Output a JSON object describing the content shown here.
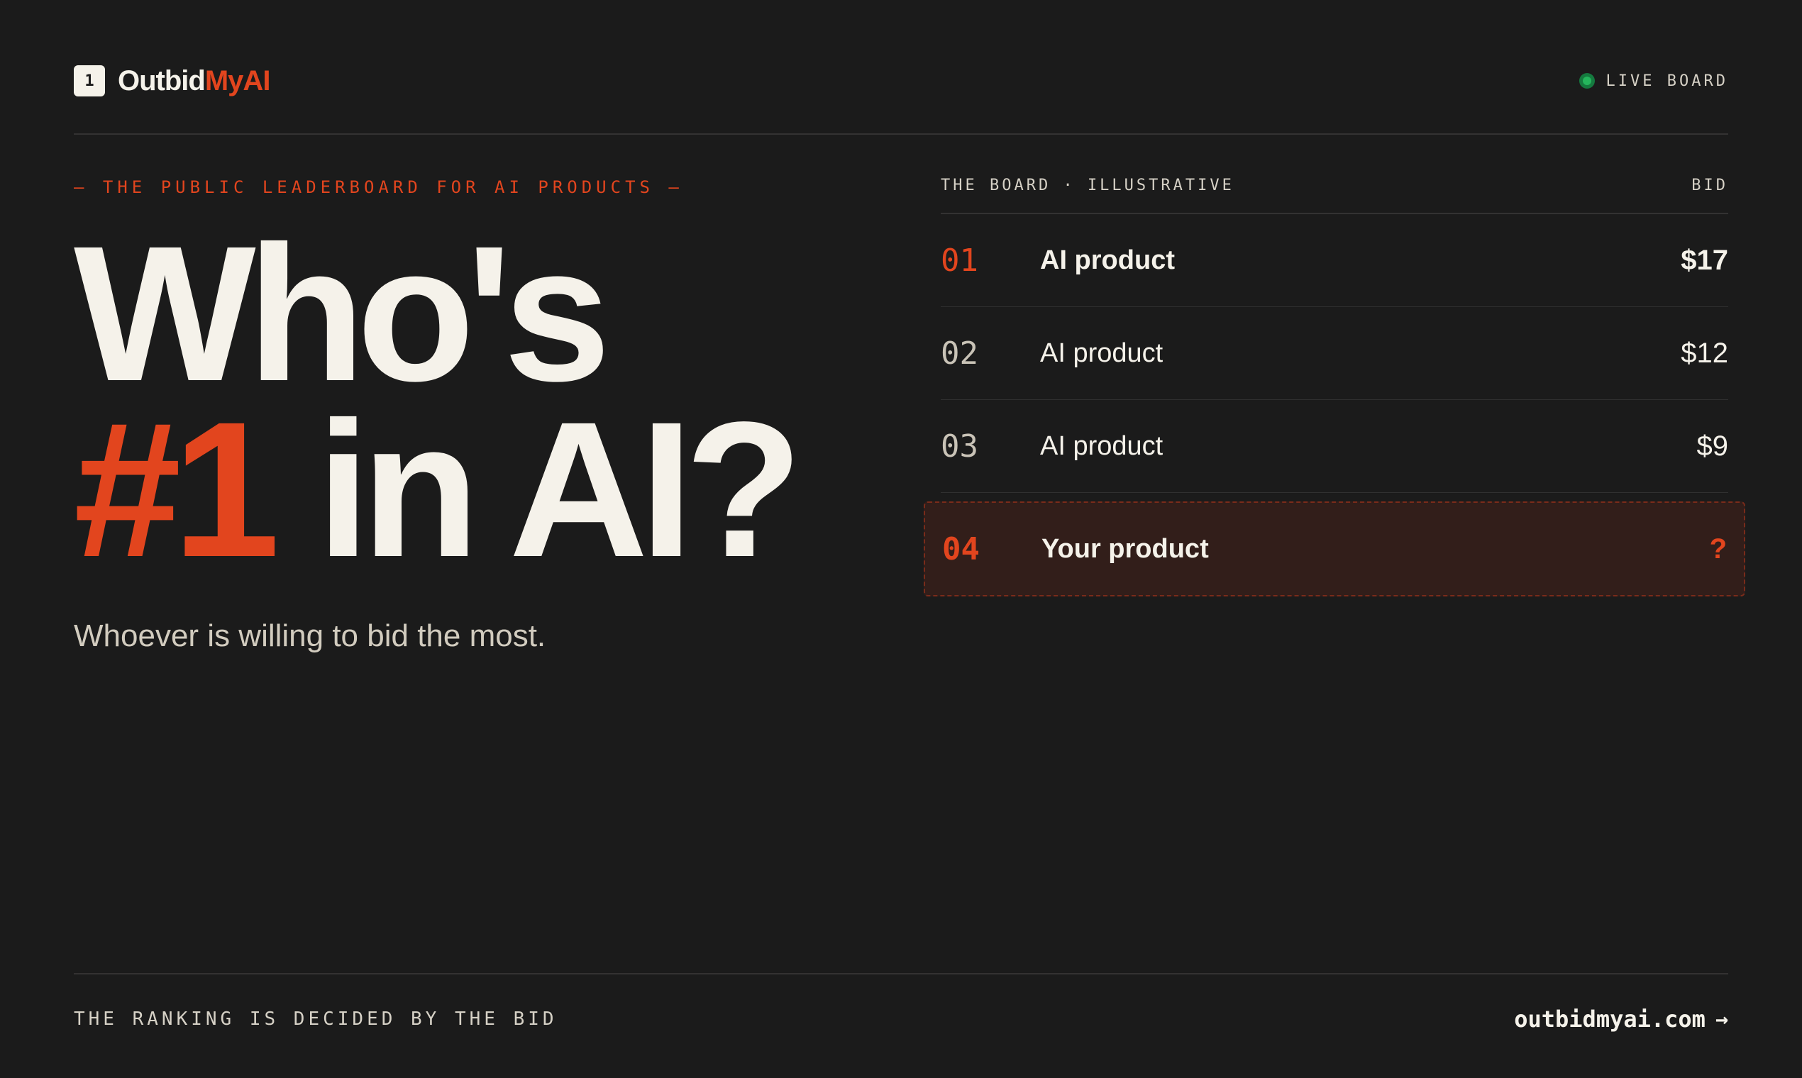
{
  "header": {
    "badge": "1",
    "brand_primary": "Outbid",
    "brand_accent": "MyAI",
    "live_label": "LIVE BOARD"
  },
  "hero": {
    "tagline": "— THE PUBLIC LEADERBOARD FOR AI PRODUCTS —",
    "title_line1": "Who's",
    "title_highlight": "#1",
    "title_line2_rest": " in AI?",
    "subtitle": "Whoever is willing to bid the most."
  },
  "board": {
    "heading": "THE BOARD · ILLUSTRATIVE",
    "bid_heading": "BID",
    "rows": [
      {
        "rank": "01",
        "name": "AI product",
        "bid": "$17"
      },
      {
        "rank": "02",
        "name": "AI product",
        "bid": "$12"
      },
      {
        "rank": "03",
        "name": "AI product",
        "bid": "$9"
      },
      {
        "rank": "04",
        "name": "Your product",
        "bid": "?"
      }
    ]
  },
  "footer": {
    "note": "THE RANKING IS DECIDED BY THE BID",
    "link_text": "outbidmyai.com",
    "arrow": "→"
  },
  "colors": {
    "background": "#1b1b1b",
    "accent": "#e2451e",
    "text": "#f5f2ea",
    "live": "#25b55c"
  }
}
